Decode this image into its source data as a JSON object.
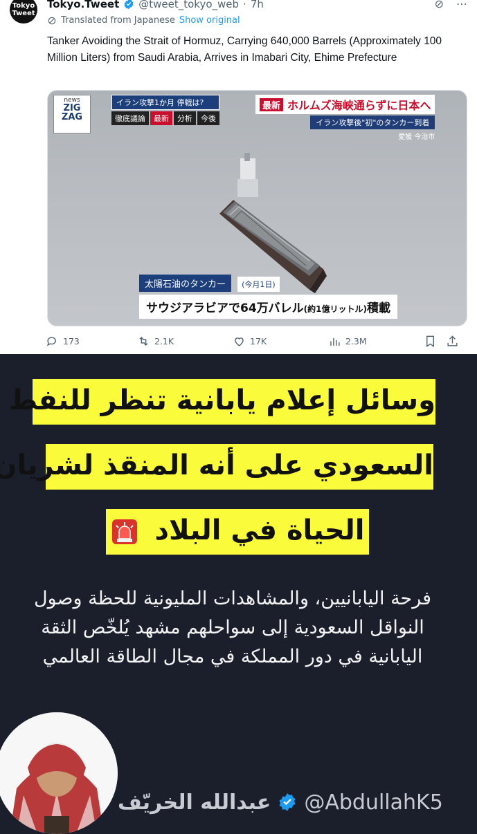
{
  "tweet": {
    "avatar_text_line1": "Tokyo",
    "avatar_text_line2": "Tweet",
    "display_name": "Tokyo.Tweet",
    "handle": "@tweet_tokyo_web",
    "separator": "·",
    "time": "7h",
    "translated_label": "Translated from Japanese",
    "show_original": "Show original",
    "text": "Tanker Avoiding the Strait of Hormuz, Carrying 640,000 Barrels (Approximately 100 Million Liters) from Saudi Arabia, Arrives in Imabari City, Ehime Prefecture",
    "media": {
      "logo_small": "news",
      "logo_line1": "ZIG",
      "logo_line2": "ZAG",
      "tag_top": "イラン攻撃1か月 停戦は?",
      "tags": [
        "徹底議論",
        "最新",
        "分析",
        "今後"
      ],
      "headline_badge": "最新",
      "headline": "ホルムズ海峡通らずに日本へ",
      "sub": "イラン攻撃後\"初\"のタンカー到着",
      "location": "愛媛 今治市",
      "caption_top": "太陽石油のタンカー",
      "caption_date": "(今月1日)",
      "caption_main_a": "サウジアラビアで64万バレル",
      "caption_main_small": "(約1億リットル)",
      "caption_main_b": "積載"
    },
    "actions": {
      "replies": "173",
      "reposts": "2.1K",
      "likes": "17K",
      "views": "2.3M"
    }
  },
  "overlay": {
    "headline_lines": [
      "وسائل إعلام يابانية تنظر للنفط",
      "السعودي على أنه المنقذ لشريان",
      "الحياة في البلاد"
    ],
    "body": "فرحة اليابانيين، والمشاهدات المليونية للحظة وصول النواقل السعودية إلى سواحلهم مشهد يُلخّص الثقة اليابانية في دور المملكة في مجال الطاقة العالمي",
    "author_name": "عبدالله الخريّف",
    "author_handle": "@AbdullahK5"
  },
  "colors": {
    "highlight": "#fafb3a",
    "dark_bg": "#1b1f2c",
    "verified_blue": "#1d9bf0",
    "news_red": "#c8102e"
  }
}
